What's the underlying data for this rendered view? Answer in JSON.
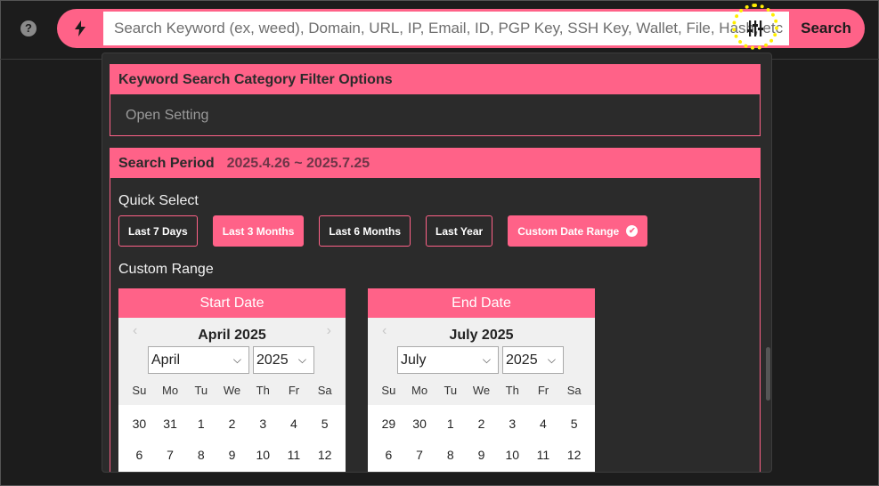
{
  "header": {
    "help_icon": "question-circle-icon",
    "search_placeholder": "Search Keyword (ex, weed), Domain, URL, IP, Email, ID, PGP Key, SSH Key, Wallet, File, Hash, etc",
    "search_label": "Search"
  },
  "filter_panel": {
    "category": {
      "title": "Keyword Search Category Filter Options",
      "open_setting": "Open Setting"
    },
    "period": {
      "title": "Search Period",
      "range": "2025.4.26 ~ 2025.7.25",
      "quick_select_title": "Quick Select",
      "quick_options": [
        "Last 7 Days",
        "Last 3 Months",
        "Last 6 Months",
        "Last Year",
        "Custom Date Range"
      ],
      "custom_range_title": "Custom Range"
    }
  },
  "start_calendar": {
    "header": "Start Date",
    "month_title": "April 2025",
    "month": "April",
    "year": "2025",
    "weekdays": [
      "Su",
      "Mo",
      "Tu",
      "We",
      "Th",
      "Fr",
      "Sa"
    ],
    "week1": [
      "30",
      "31",
      "1",
      "2",
      "3",
      "4",
      "5"
    ],
    "week2": [
      "6",
      "7",
      "8",
      "9",
      "10",
      "11",
      "12"
    ]
  },
  "end_calendar": {
    "header": "End Date",
    "month_title": "July 2025",
    "month": "July",
    "year": "2025",
    "weekdays": [
      "Su",
      "Mo",
      "Tu",
      "We",
      "Th",
      "Fr",
      "Sa"
    ],
    "week1": [
      "29",
      "30",
      "1",
      "2",
      "3",
      "4",
      "5"
    ],
    "week2": [
      "6",
      "7",
      "8",
      "9",
      "10",
      "11",
      "12"
    ]
  },
  "colors": {
    "accent": "#ff6288",
    "highlight": "#ffee00",
    "panel_bg": "#2b2b2b",
    "page_bg": "#1c1c1c"
  }
}
